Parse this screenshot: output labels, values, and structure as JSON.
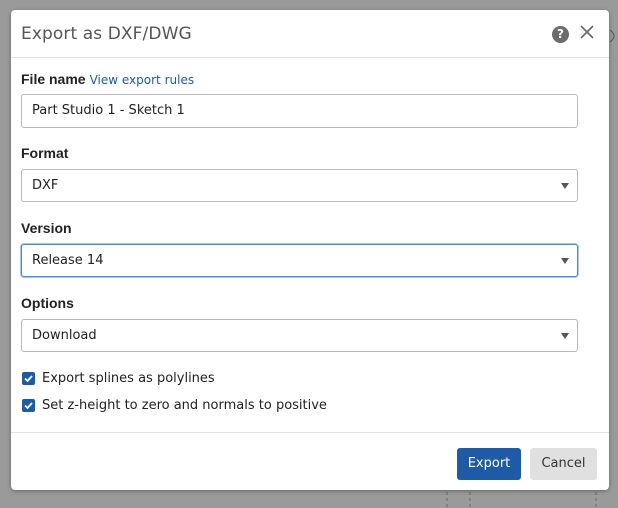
{
  "dialog": {
    "title": "Export as DXF/DWG",
    "help_icon": "help-icon",
    "help_glyph": "?",
    "close_icon": "close-icon"
  },
  "file_name": {
    "label": "File name",
    "link": "View export rules",
    "value": "Part Studio 1 - Sketch 1"
  },
  "format": {
    "label": "Format",
    "selected": "DXF"
  },
  "version": {
    "label": "Version",
    "selected": "Release 14"
  },
  "options": {
    "label": "Options",
    "selected": "Download"
  },
  "checkboxes": [
    {
      "label": "Export splines as polylines",
      "checked": true
    },
    {
      "label": "Set z-height to zero and normals to positive",
      "checked": true
    }
  ],
  "footer": {
    "export_label": "Export",
    "cancel_label": "Cancel"
  },
  "colors": {
    "accent": "#1f5aa6",
    "focus": "#4a8ad6"
  }
}
